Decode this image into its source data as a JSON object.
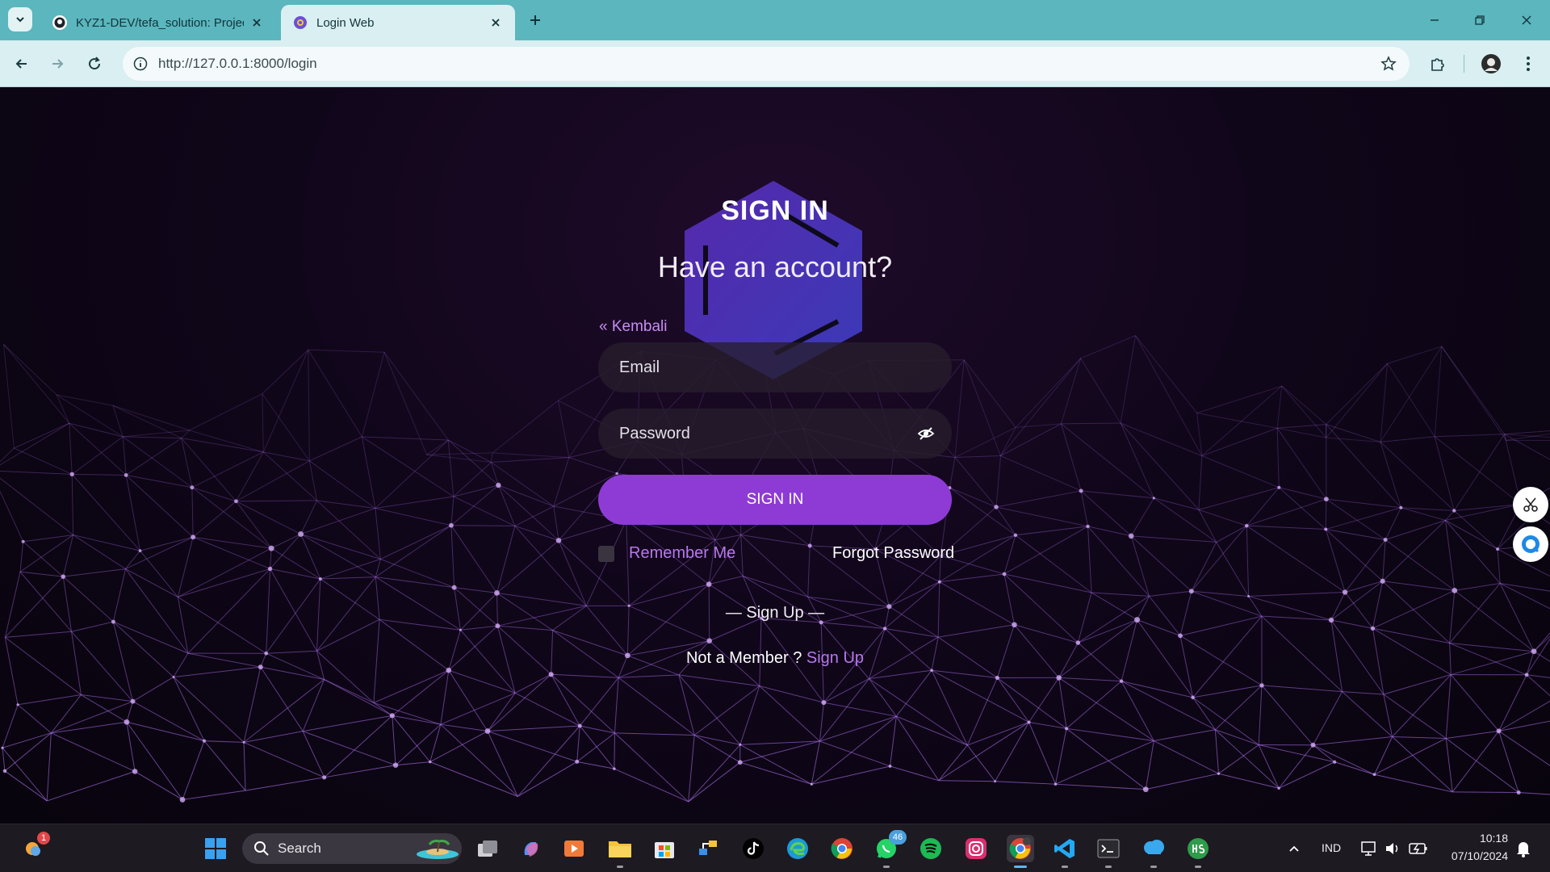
{
  "browser": {
    "tabs": [
      {
        "title": "KYZ1-DEV/tefa_solution: Projec",
        "favicon": "github-icon",
        "active": false
      },
      {
        "title": "Login Web",
        "favicon": "gear-favicon-icon",
        "active": true
      }
    ],
    "address_bar": {
      "url": "http://127.0.0.1:8000/login"
    }
  },
  "login": {
    "heading": "SIGN IN",
    "subheading": "Have an account?",
    "back_link": "« Kembali",
    "email_placeholder": "Email",
    "password_placeholder": "Password",
    "submit_label": "SIGN IN",
    "remember_label": "Remember Me",
    "forgot_label": "Forgot Password",
    "signup_divider": "— Sign Up —",
    "not_member_text": "Not a Member ?",
    "signup_link": "Sign Up"
  },
  "colors": {
    "accent": "#8e3bd6",
    "link": "#b878ee",
    "tabstrip": "#5bb6be"
  },
  "taskbar": {
    "search_label": "Search",
    "whatsapp_badge": "46",
    "weather_badge": "1",
    "language": "IND",
    "time": "10:18",
    "date": "07/10/2024"
  }
}
